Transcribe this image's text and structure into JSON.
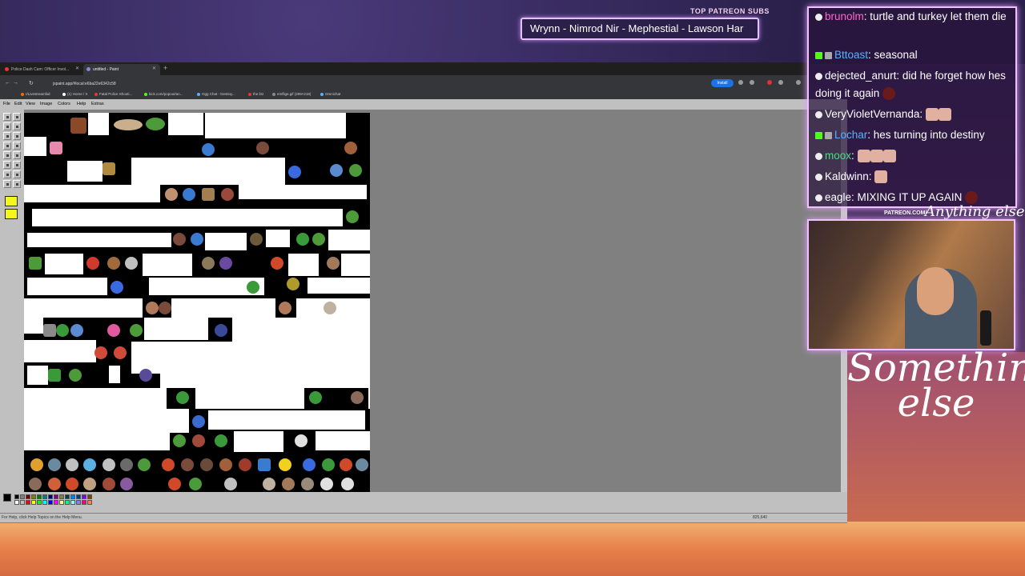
{
  "patreon": {
    "label": "TOP PATREON SUBS",
    "names": "Wrynn - Nimrod Nir - Mephestial - Lawson Har"
  },
  "browser": {
    "tabs": [
      {
        "label": "Police Dash Cam: Officer Invol...",
        "active": false
      },
      {
        "label": "untitled - Paint",
        "active": true
      }
    ],
    "url": "jspaint.app/#local:e6ba22e6342c58",
    "install_label": "Install",
    "bookmarks": [
      "r/Livestreamfail",
      "(1) Home / X",
      "Fatal Police Shooti...",
      "kick.com/popout/an...",
      "Ogg Chat - Destiny...",
      "the list",
      "emflige.gif (299×218)",
      "Omnichat"
    ]
  },
  "paint": {
    "menus": [
      "File",
      "Edit",
      "View",
      "Image",
      "Colors",
      "Help",
      "Extras"
    ],
    "status_text": "For Help, click Help Topics on the Help Menu.",
    "coords": "825,640",
    "palette": [
      "#000000",
      "#808080",
      "#800000",
      "#808000",
      "#008000",
      "#008080",
      "#000080",
      "#800080",
      "#808040",
      "#004040",
      "#0080ff",
      "#004080",
      "#8000ff",
      "#804000",
      "#ffffff",
      "#c0c0c0",
      "#ff0000",
      "#ffff00",
      "#00ff00",
      "#00ffff",
      "#0000ff",
      "#ff00ff",
      "#ffff80",
      "#00ff80",
      "#80ffff",
      "#8080ff",
      "#ff0080",
      "#ff8040"
    ]
  },
  "chat": {
    "messages": [
      {
        "user": "brunolm",
        "color": "#ff66cc",
        "text": ": turtle and turkey let them die"
      },
      {
        "user": "Bttoast",
        "color": "#5ab0ff",
        "text": ": seasonal"
      },
      {
        "user": "dejected_anurt",
        "color": "#ffffff",
        "text": ": did he forget how hes doing it again"
      },
      {
        "user": "VeryVioletVernanda",
        "color": "#ffffff",
        "text": ":"
      },
      {
        "user": "Lochar",
        "color": "#5ab0ff",
        "text": ": hes turning into destiny"
      },
      {
        "user": "moox",
        "color": "#4ade80",
        "text": ":"
      },
      {
        "user": "Kaldwinn",
        "color": "#ffffff",
        "text": ":"
      },
      {
        "user": "eagle",
        "color": "#ffffff",
        "text": ": MIXING IT UP AGAIN"
      }
    ]
  },
  "overlay": {
    "cam_label": "PATREON.COM/",
    "cam_sign": "Anything else",
    "brand": "Something else"
  }
}
